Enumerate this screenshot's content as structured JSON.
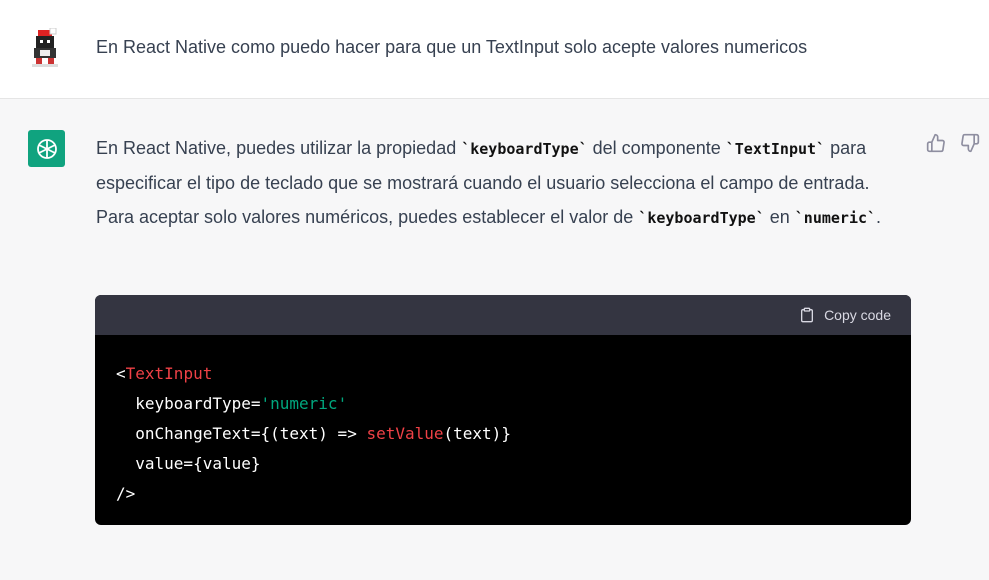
{
  "user": {
    "message": "En React Native como puedo hacer para que un TextInput solo acepte valores numericos"
  },
  "assistant": {
    "p1_a": "En React Native, puedes utilizar la propiedad ",
    "p1_code1": "`keyboardType`",
    "p1_b": " del componente ",
    "p1_code2": "`TextInput`",
    "p1_c": " para especificar el tipo de teclado que se mostrará cuando el usuario selecciona el campo de entrada. Para aceptar solo valores numéricos, puedes establecer el valor de ",
    "p1_code3": "`keyboardType`",
    "p1_d": " en ",
    "p1_code4": "`numeric`",
    "p1_e": "."
  },
  "code": {
    "copy_label": "Copy code",
    "l1_open": "<",
    "l1_tag": "TextInput",
    "l2_attr": "  keyboardType=",
    "l2_str": "'numeric'",
    "l3_a": "  onChangeText={(text) => ",
    "l3_fn": "setValue",
    "l3_b": "(text)}",
    "l4": "  value={value}",
    "l5": "/>"
  },
  "icons": {
    "user_avatar": "pixel-avatar-icon",
    "assistant_avatar": "openai-logo-icon",
    "thumbs_up": "thumbs-up-icon",
    "thumbs_down": "thumbs-down-icon",
    "copy": "clipboard-icon"
  },
  "colors": {
    "assistant_bg": "#f7f7f8",
    "gpt_green": "#10a37f",
    "code_bg": "#000000",
    "code_header_bg": "#343541",
    "code_red": "#ef4146",
    "code_green": "#00a67d"
  }
}
